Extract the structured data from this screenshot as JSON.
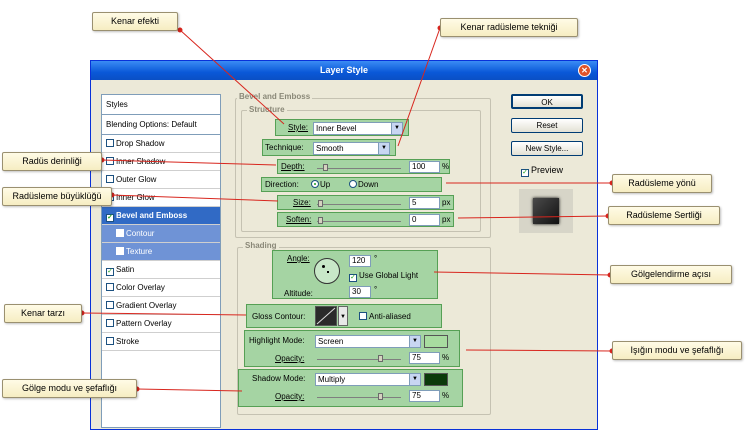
{
  "dialog": {
    "title": "Layer Style",
    "buttons": {
      "ok": "OK",
      "reset": "Reset",
      "new_style": "New Style...",
      "preview": "Preview"
    },
    "preview_checked": true
  },
  "sidebar": {
    "header": "Styles",
    "items": [
      {
        "label": "Blending Options: Default",
        "checkbox": false
      },
      {
        "label": "Drop Shadow",
        "checkbox": true,
        "checked": false
      },
      {
        "label": "Inner Shadow",
        "checkbox": true,
        "checked": false
      },
      {
        "label": "Outer Glow",
        "checkbox": true,
        "checked": false
      },
      {
        "label": "Inner Glow",
        "checkbox": true,
        "checked": false
      },
      {
        "label": "Bevel and Emboss",
        "checkbox": true,
        "checked": true,
        "selected": true
      },
      {
        "label": "Contour",
        "checkbox": true,
        "checked": false,
        "sub": true
      },
      {
        "label": "Texture",
        "checkbox": true,
        "checked": false,
        "sub": true
      },
      {
        "label": "Satin",
        "checkbox": true,
        "checked": true
      },
      {
        "label": "Color Overlay",
        "checkbox": true,
        "checked": false
      },
      {
        "label": "Gradient Overlay",
        "checkbox": true,
        "checked": false
      },
      {
        "label": "Pattern Overlay",
        "checkbox": true,
        "checked": false
      },
      {
        "label": "Stroke",
        "checkbox": true,
        "checked": false
      }
    ]
  },
  "bevel": {
    "section_title": "Bevel and Emboss",
    "structure_title": "Structure",
    "style_label": "Style:",
    "style_value": "Inner Bevel",
    "technique_label": "Technique:",
    "technique_value": "Smooth",
    "depth_label": "Depth:",
    "depth_value": "100",
    "depth_unit": "%",
    "direction_label": "Direction:",
    "direction_up": "Up",
    "direction_down": "Down",
    "size_label": "Size:",
    "size_value": "5",
    "size_unit": "px",
    "soften_label": "Soften:",
    "soften_value": "0",
    "soften_unit": "px"
  },
  "shading": {
    "title": "Shading",
    "angle_label": "Angle:",
    "angle_value": "120",
    "angle_unit": "°",
    "global_light_label": "Use Global Light",
    "altitude_label": "Altitude:",
    "altitude_value": "30",
    "altitude_unit": "°",
    "gloss_label": "Gloss Contour:",
    "antialiased_label": "Anti-aliased",
    "highlight_label": "Highlight Mode:",
    "highlight_value": "Screen",
    "highlight_opacity_label": "Opacity:",
    "highlight_opacity_value": "75",
    "highlight_opacity_unit": "%",
    "shadow_label": "Shadow Mode:",
    "shadow_value": "Multiply",
    "shadow_opacity_label": "Opacity:",
    "shadow_opacity_value": "75",
    "shadow_opacity_unit": "%"
  },
  "colors": {
    "highlight_swatch": "#a8dca0",
    "shadow_swatch": "#0a3a0a",
    "annotation_line": "#d8261e",
    "highlight_box": "#9fd39f"
  },
  "callouts": {
    "edge_effect": "Kenar efekti",
    "edge_rounding_technique": "Kenar radüsleme tekniği",
    "rounding_depth": "Radüs derinliği",
    "rounding_direction": "Radüsleme yönü",
    "rounding_size": "Radüsleme büyüklüğü",
    "rounding_hardness": "Radüsleme Sertliği",
    "shading_angle": "Gölgelendirme açısı",
    "edge_style": "Kenar tarzı",
    "light_mode_opacity": "Işığın modu ve şefaflığı",
    "shadow_mode_opacity": "Gölge modu ve şefaflığı"
  }
}
